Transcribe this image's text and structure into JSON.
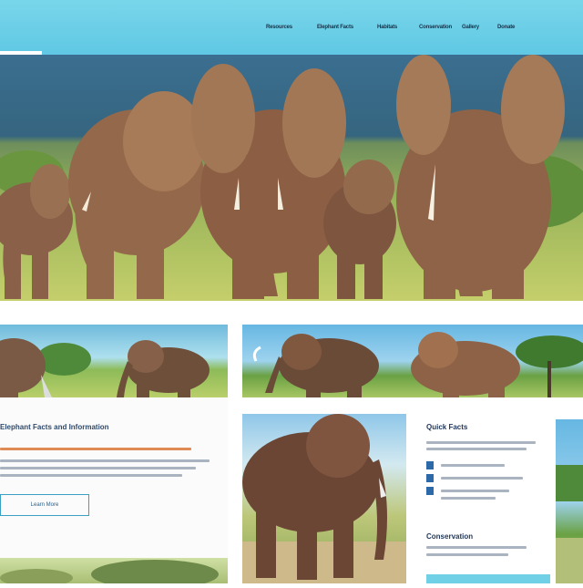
{
  "nav": {
    "items": [
      "Resources",
      "Elephant Facts",
      "Habitats",
      "Conservation",
      "Gallery",
      "Donate"
    ]
  },
  "colors": {
    "nav_bg": "#6fd0e6",
    "accent": "#3aa0c4",
    "heading": "#23395a"
  },
  "cards": {
    "left_title": "Elephant Facts and Information",
    "left_button": "Learn More",
    "right_title": "Quick Facts",
    "right_footer": "Conservation"
  }
}
